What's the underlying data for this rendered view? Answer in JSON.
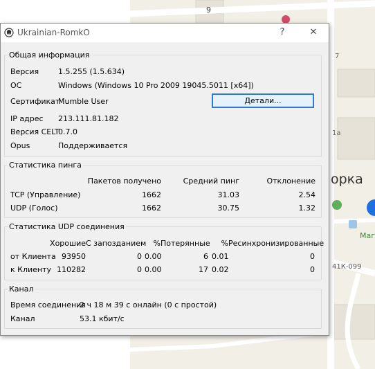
{
  "window": {
    "title": "Ukrainian-RomkO",
    "help": "?",
    "close": "✕"
  },
  "general": {
    "legend": "Общая информация",
    "version_label": "Версия",
    "version_value": "1.5.255 (1.5.634)",
    "os_label": "ОС",
    "os_value": "Windows (Windows 10 Pro 2009 19045.5011 [x64])",
    "cert_label": "Сертификат",
    "cert_value": "Mumble User",
    "details_button": "Детали...",
    "ip_label": "IP адрес",
    "ip_value": "213.111.81.182",
    "celt_label": "Версия CELT",
    "celt_value": "0.7.0",
    "opus_label": "Opus",
    "opus_value": "Поддерживается"
  },
  "ping": {
    "legend": "Статистика пинга",
    "headers": [
      "Пакетов получено",
      "Средний пинг",
      "Отклонение"
    ],
    "rows": [
      {
        "label": "TCP (Управление)",
        "packets": "1662",
        "avg": "31.03",
        "dev": "2.54"
      },
      {
        "label": "UDP (Голос)",
        "packets": "1662",
        "avg": "30.75",
        "dev": "1.32"
      }
    ]
  },
  "udp": {
    "legend": "Статистика UDP соединения",
    "headers": [
      "Хорошие",
      "С запозданием",
      "%",
      "Потерянные",
      "%",
      "Ресинхронизированные"
    ],
    "rows": [
      {
        "label": "от Клиента",
        "good": "93950",
        "late": "0",
        "late_pct": "0.00",
        "lost": "6",
        "lost_pct": "0.01",
        "resync": "0"
      },
      {
        "label": "к Клиенту",
        "good": "110282",
        "late": "0",
        "late_pct": "0.00",
        "lost": "17",
        "lost_pct": "0.02",
        "resync": "0"
      }
    ]
  },
  "channel": {
    "legend": "Канал",
    "time_label": "Время соединения",
    "time_value": "2 ч 18 м 39 с онлайн (0 с простой)",
    "channel_label": "Канал",
    "channel_value": "53.1 кбит/с"
  },
  "map": {
    "labels": {
      "house_9": "9",
      "town": "орка",
      "road": "41К-099",
      "shop": "Маг",
      "side_1": "1а",
      "side_2": "7"
    },
    "colors": {
      "land": "#f2efe6",
      "road": "#ffffff",
      "pin": "#1e6fe0"
    }
  }
}
